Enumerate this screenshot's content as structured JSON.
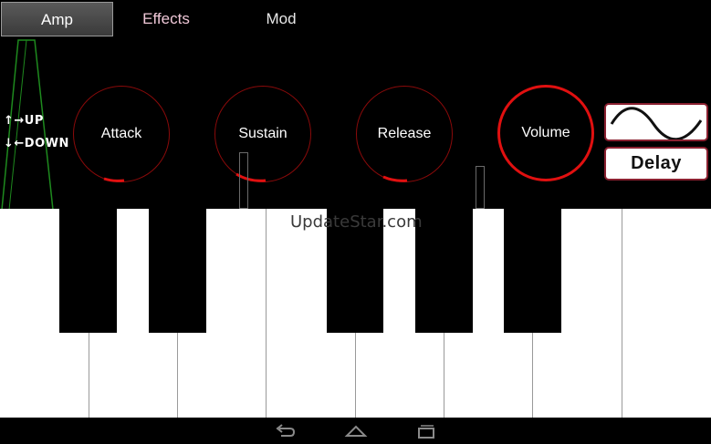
{
  "tabs": [
    {
      "label": "Amp",
      "active": true
    },
    {
      "label": "Effects",
      "active": false
    },
    {
      "label": "Mod",
      "active": false
    }
  ],
  "direction_hints": {
    "up": "↑→UP",
    "down": "↓←DOWN"
  },
  "knobs": [
    {
      "label": "Attack",
      "level": 0.08
    },
    {
      "label": "Sustain",
      "level": 0.12
    },
    {
      "label": "Release",
      "level": 0.1
    },
    {
      "label": "Volume",
      "level": 1.0
    }
  ],
  "waveform": {
    "icon": "sine-wave-icon"
  },
  "delay_label": "Delay",
  "watermark": "UpdateStar.com",
  "colors": {
    "accent_red": "#e01010",
    "dark_red": "#8a0a0a",
    "pitch_green": "#1e8a1e"
  },
  "navbar": {
    "icons": [
      "back-icon",
      "home-icon",
      "recent-apps-icon"
    ]
  }
}
